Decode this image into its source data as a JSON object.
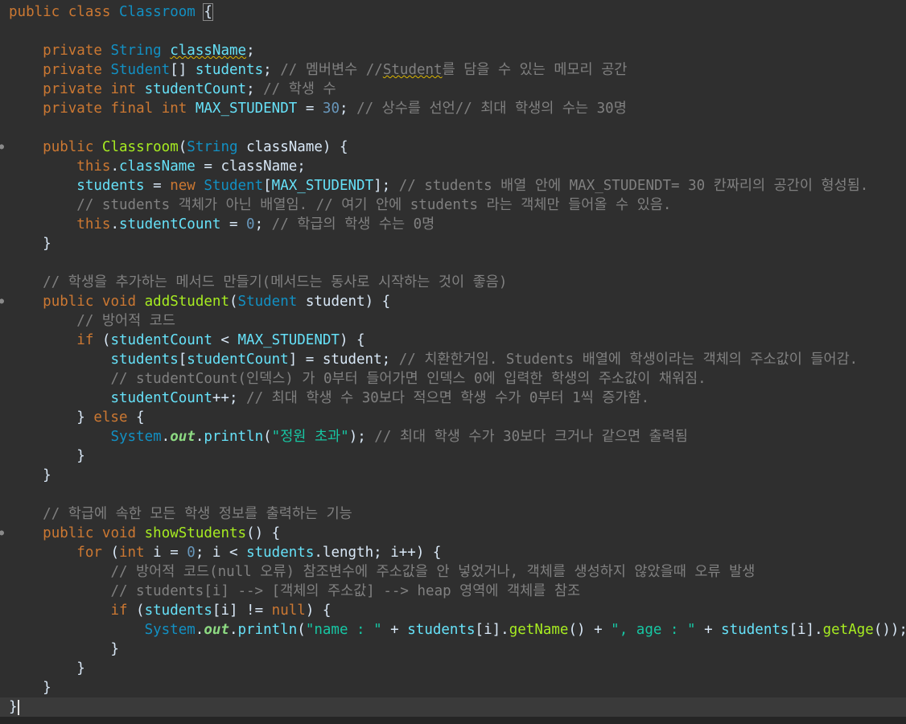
{
  "editor": {
    "lines": [
      [
        {
          "t": "public",
          "c": "kw"
        },
        {
          "t": " "
        },
        {
          "t": "class",
          "c": "kw"
        },
        {
          "t": " "
        },
        {
          "t": "Classroom",
          "c": "cls"
        },
        {
          "t": " "
        },
        {
          "t": "{",
          "c": "pl",
          "x": "cursor-box"
        }
      ],
      [],
      [
        {
          "t": "    "
        },
        {
          "t": "private",
          "c": "kw"
        },
        {
          "t": " "
        },
        {
          "t": "String",
          "c": "ty"
        },
        {
          "t": " "
        },
        {
          "t": "className",
          "c": "fd",
          "x": "wavy"
        },
        {
          "t": ";"
        }
      ],
      [
        {
          "t": "    "
        },
        {
          "t": "private",
          "c": "kw"
        },
        {
          "t": " "
        },
        {
          "t": "Student",
          "c": "ty"
        },
        {
          "t": "[] "
        },
        {
          "t": "students",
          "c": "fd"
        },
        {
          "t": "; "
        },
        {
          "t": "// 멤버변수 //",
          "c": "cm"
        },
        {
          "t": "Student",
          "c": "cm",
          "x": "wavy"
        },
        {
          "t": "를 담을 수 있는 메모리 공간",
          "c": "cm"
        }
      ],
      [
        {
          "t": "    "
        },
        {
          "t": "private",
          "c": "kw"
        },
        {
          "t": " "
        },
        {
          "t": "int",
          "c": "kw"
        },
        {
          "t": " "
        },
        {
          "t": "studentCount",
          "c": "fd"
        },
        {
          "t": "; "
        },
        {
          "t": "// 학생 수",
          "c": "cm"
        }
      ],
      [
        {
          "t": "    "
        },
        {
          "t": "private",
          "c": "kw"
        },
        {
          "t": " "
        },
        {
          "t": "final",
          "c": "kw"
        },
        {
          "t": " "
        },
        {
          "t": "int",
          "c": "kw"
        },
        {
          "t": " "
        },
        {
          "t": "MAX_STUDENDT",
          "c": "fd"
        },
        {
          "t": " = "
        },
        {
          "t": "30",
          "c": "num"
        },
        {
          "t": "; "
        },
        {
          "t": "// 상수를 선언// 최대 학생의 수는 30명",
          "c": "cm"
        }
      ],
      [],
      [
        {
          "t": "    "
        },
        {
          "t": "public",
          "c": "kw"
        },
        {
          "t": " "
        },
        {
          "t": "Classroom",
          "c": "fn"
        },
        {
          "t": "("
        },
        {
          "t": "String",
          "c": "ty"
        },
        {
          "t": " "
        },
        {
          "t": "className",
          "c": "lc"
        },
        {
          "t": ") {"
        }
      ],
      [
        {
          "t": "        "
        },
        {
          "t": "this",
          "c": "kw"
        },
        {
          "t": "."
        },
        {
          "t": "className",
          "c": "fd"
        },
        {
          "t": " = "
        },
        {
          "t": "className",
          "c": "lc"
        },
        {
          "t": ";"
        }
      ],
      [
        {
          "t": "        "
        },
        {
          "t": "students",
          "c": "fd"
        },
        {
          "t": " = "
        },
        {
          "t": "new",
          "c": "kw"
        },
        {
          "t": " "
        },
        {
          "t": "Student",
          "c": "ty"
        },
        {
          "t": "["
        },
        {
          "t": "MAX_STUDENDT",
          "c": "fd"
        },
        {
          "t": "]; "
        },
        {
          "t": "// students 배열 안에 MAX_STUDENDT= 30 칸짜리의 공간이 형성됨.",
          "c": "cm"
        }
      ],
      [
        {
          "t": "        "
        },
        {
          "t": "// students 객체가 아닌 배열임. // 여기 안에 students 라는 객체만 들어올 수 있음.",
          "c": "cm"
        }
      ],
      [
        {
          "t": "        "
        },
        {
          "t": "this",
          "c": "kw"
        },
        {
          "t": "."
        },
        {
          "t": "studentCount",
          "c": "fd"
        },
        {
          "t": " = "
        },
        {
          "t": "0",
          "c": "num"
        },
        {
          "t": "; "
        },
        {
          "t": "// 학급의 학생 수는 0명",
          "c": "cm"
        }
      ],
      [
        {
          "t": "    }"
        }
      ],
      [],
      [
        {
          "t": "    "
        },
        {
          "t": "// 학생을 추가하는 메서드 만들기(메서드는 동사로 시작하는 것이 좋음)",
          "c": "cm"
        }
      ],
      [
        {
          "t": "    "
        },
        {
          "t": "public",
          "c": "kw"
        },
        {
          "t": " "
        },
        {
          "t": "void",
          "c": "kw"
        },
        {
          "t": " "
        },
        {
          "t": "addStudent",
          "c": "fn"
        },
        {
          "t": "("
        },
        {
          "t": "Student",
          "c": "ty"
        },
        {
          "t": " "
        },
        {
          "t": "student",
          "c": "lc"
        },
        {
          "t": ") {"
        }
      ],
      [
        {
          "t": "        "
        },
        {
          "t": "// 방어적 코드",
          "c": "cm"
        }
      ],
      [
        {
          "t": "        "
        },
        {
          "t": "if",
          "c": "kw"
        },
        {
          "t": " ("
        },
        {
          "t": "studentCount",
          "c": "fd"
        },
        {
          "t": " < "
        },
        {
          "t": "MAX_STUDENDT",
          "c": "fd"
        },
        {
          "t": ") {"
        }
      ],
      [
        {
          "t": "            "
        },
        {
          "t": "students",
          "c": "fd"
        },
        {
          "t": "["
        },
        {
          "t": "studentCount",
          "c": "fd"
        },
        {
          "t": "] = "
        },
        {
          "t": "student",
          "c": "lc"
        },
        {
          "t": "; "
        },
        {
          "t": "// 치환한거임. Students 배열에 학생이라는 객체의 주소값이 들어감.",
          "c": "cm"
        }
      ],
      [
        {
          "t": "            "
        },
        {
          "t": "// studentCount(인덱스) 가 0부터 들어가면 인덱스 0에 입력한 학생의 주소값이 채워짐.",
          "c": "cm"
        }
      ],
      [
        {
          "t": "            "
        },
        {
          "t": "studentCount",
          "c": "fd"
        },
        {
          "t": "++; "
        },
        {
          "t": "// 최대 학생 수 30보다 적으면 학생 수가 0부터 1씩 증가함.",
          "c": "cm"
        }
      ],
      [
        {
          "t": "        } "
        },
        {
          "t": "else",
          "c": "kw"
        },
        {
          "t": " {"
        }
      ],
      [
        {
          "t": "            "
        },
        {
          "t": "System",
          "c": "ty"
        },
        {
          "t": "."
        },
        {
          "t": "out",
          "c": "st"
        },
        {
          "t": "."
        },
        {
          "t": "println",
          "c": "fd"
        },
        {
          "t": "("
        },
        {
          "t": "\"정원 초과\"",
          "c": "str"
        },
        {
          "t": "); "
        },
        {
          "t": "// 최대 학생 수가 30보다 크거나 같으면 출력됨",
          "c": "cm"
        }
      ],
      [
        {
          "t": "        }"
        }
      ],
      [
        {
          "t": "    }"
        }
      ],
      [],
      [
        {
          "t": "    "
        },
        {
          "t": "// 학급에 속한 모든 학생 정보를 출력하는 기능",
          "c": "cm"
        }
      ],
      [
        {
          "t": "    "
        },
        {
          "t": "public",
          "c": "kw"
        },
        {
          "t": " "
        },
        {
          "t": "void",
          "c": "kw"
        },
        {
          "t": " "
        },
        {
          "t": "showStudents",
          "c": "fn"
        },
        {
          "t": "() {"
        }
      ],
      [
        {
          "t": "        "
        },
        {
          "t": "for",
          "c": "kw"
        },
        {
          "t": " ("
        },
        {
          "t": "int",
          "c": "kw"
        },
        {
          "t": " "
        },
        {
          "t": "i",
          "c": "lc"
        },
        {
          "t": " = "
        },
        {
          "t": "0",
          "c": "num"
        },
        {
          "t": "; "
        },
        {
          "t": "i",
          "c": "lc"
        },
        {
          "t": " < "
        },
        {
          "t": "students",
          "c": "fd"
        },
        {
          "t": ".length; "
        },
        {
          "t": "i",
          "c": "lc"
        },
        {
          "t": "++) {"
        }
      ],
      [
        {
          "t": "            "
        },
        {
          "t": "// 방어적 코드(null 오류) 참조변수에 주소값을 안 넣었거나, 객체를 생성하지 않았을때 오류 발생",
          "c": "cm"
        }
      ],
      [
        {
          "t": "            "
        },
        {
          "t": "// students[i] --> [객체의 주소값] --> heap 영역에 객체를 참조",
          "c": "cm"
        }
      ],
      [
        {
          "t": "            "
        },
        {
          "t": "if",
          "c": "kw"
        },
        {
          "t": " ("
        },
        {
          "t": "students",
          "c": "fd"
        },
        {
          "t": "["
        },
        {
          "t": "i",
          "c": "lc"
        },
        {
          "t": "] != "
        },
        {
          "t": "null",
          "c": "kw"
        },
        {
          "t": ") {"
        }
      ],
      [
        {
          "t": "                "
        },
        {
          "t": "System",
          "c": "ty"
        },
        {
          "t": "."
        },
        {
          "t": "out",
          "c": "st"
        },
        {
          "t": "."
        },
        {
          "t": "println",
          "c": "fd"
        },
        {
          "t": "("
        },
        {
          "t": "\"name : \"",
          "c": "str"
        },
        {
          "t": " + "
        },
        {
          "t": "students",
          "c": "fd"
        },
        {
          "t": "["
        },
        {
          "t": "i",
          "c": "lc"
        },
        {
          "t": "]."
        },
        {
          "t": "getName",
          "c": "fn"
        },
        {
          "t": "() + "
        },
        {
          "t": "\", age : \"",
          "c": "str"
        },
        {
          "t": " + "
        },
        {
          "t": "students",
          "c": "fd"
        },
        {
          "t": "["
        },
        {
          "t": "i",
          "c": "lc"
        },
        {
          "t": "]."
        },
        {
          "t": "getAge",
          "c": "fn"
        },
        {
          "t": "());"
        }
      ],
      [
        {
          "t": "            }"
        }
      ],
      [
        {
          "t": "        }"
        }
      ],
      [
        {
          "t": "    }"
        }
      ],
      [
        {
          "t": "}"
        },
        {
          "t": "",
          "x": "caret"
        }
      ]
    ],
    "fold_marker_lines": [
      7,
      15,
      27
    ],
    "current_line": 36
  }
}
